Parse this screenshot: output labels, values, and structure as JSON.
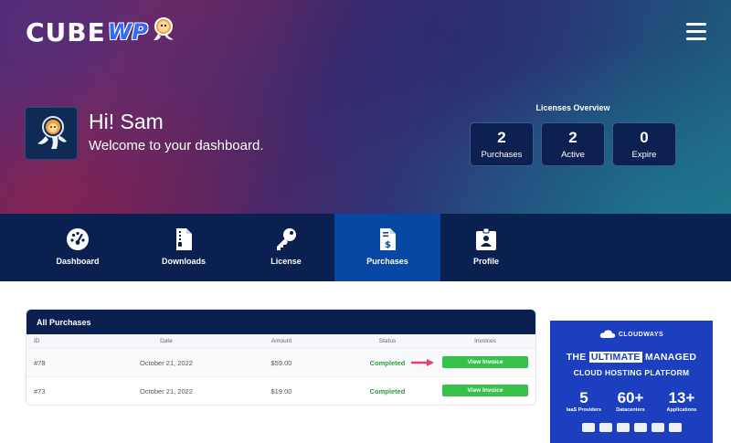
{
  "header": {
    "logo_text": "CUBE",
    "logo_accent": "WP"
  },
  "greeting": {
    "name": "Hi! Sam",
    "subtitle": "Welcome to your dashboard."
  },
  "licenses": {
    "title": "Licenses Overview",
    "items": [
      {
        "value": "2",
        "label": "Purchases"
      },
      {
        "value": "2",
        "label": "Active"
      },
      {
        "value": "0",
        "label": "Expire"
      }
    ]
  },
  "nav": {
    "items": [
      {
        "label": "Dashboard",
        "icon": "gauge-icon"
      },
      {
        "label": "Downloads",
        "icon": "file-zip-icon"
      },
      {
        "label": "License",
        "icon": "key-icon"
      },
      {
        "label": "Purchases",
        "icon": "invoice-dollar-icon",
        "active": true
      },
      {
        "label": "Profile",
        "icon": "id-badge-icon"
      }
    ]
  },
  "purchases": {
    "title": "All Purchases",
    "columns": [
      "ID",
      "Date",
      "Amount",
      "Status",
      "Invoices"
    ],
    "rows": [
      {
        "id": "#78",
        "date": "October 21, 2022",
        "amount": "$59.00",
        "status": "Completed",
        "invoice": "View Invoice"
      },
      {
        "id": "#73",
        "date": "October 21, 2022",
        "amount": "$19.00",
        "status": "Completed",
        "invoice": "View Invoice"
      }
    ]
  },
  "ad": {
    "brand": "CLOUDWAYS",
    "line1_pre": "THE",
    "line1_highlight": "ULTIMATE",
    "line1_post": "MANAGED",
    "line2": "CLOUD HOSTING PLATFORM",
    "stats": [
      {
        "value": "5",
        "label": "IaaS Providers"
      },
      {
        "value": "60+",
        "label": "Datacenters"
      },
      {
        "value": "13+",
        "label": "Applications"
      }
    ]
  },
  "colors": {
    "nav_bg": "#0a2050",
    "nav_active": "#0748a5",
    "success": "#37c24a",
    "ad_bg": "#1b3fbe"
  }
}
